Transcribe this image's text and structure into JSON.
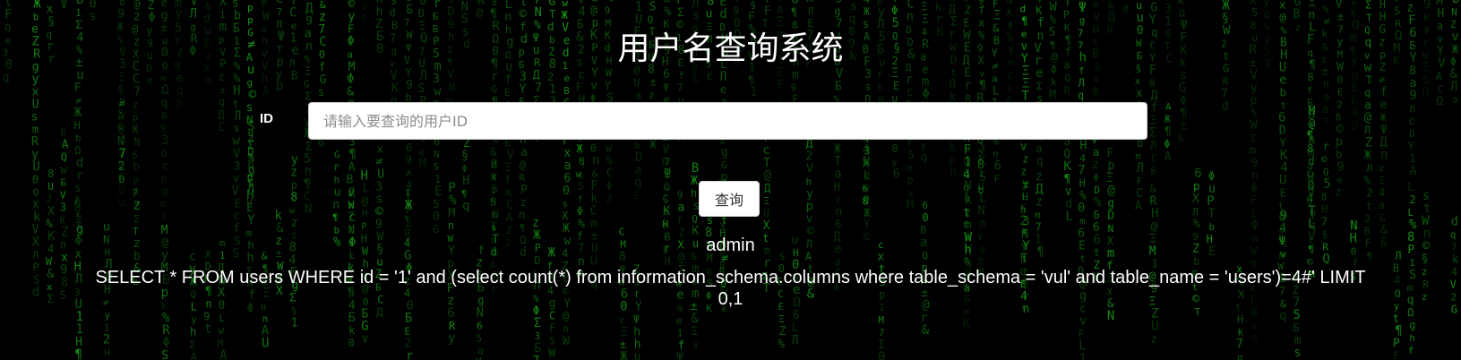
{
  "page": {
    "title": "用户名查询系统"
  },
  "form": {
    "id_label": "ID",
    "id_placeholder": "请输入要查询的用户ID",
    "id_value": "",
    "submit_label": "查询"
  },
  "result": {
    "username": "admin",
    "sql": "SELECT * FROM users WHERE id = '1' and (select count(*) from information_schema.columns where table_schema = 'vul' and table_name = 'users')=4#' LIMIT 0,1"
  },
  "theme": {
    "background": "#000000",
    "rain_color": "#1fd11f",
    "text_color": "#ffffff"
  }
}
